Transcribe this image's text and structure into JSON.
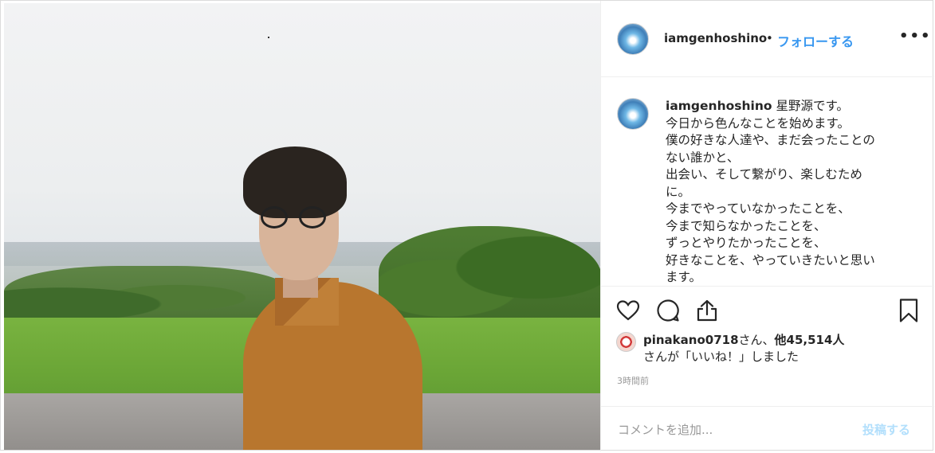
{
  "post": {
    "username": "iamgenhoshino",
    "separator": "•",
    "follow_label": "フォローする",
    "more_label": "•••"
  },
  "caption": {
    "username": "iamgenhoshino",
    "lines": [
      "星野源です。",
      "今日から色んなことを始めます。",
      "僕の好きな人達や、まだ会ったことの",
      "ない誰かと、",
      "出会い、そして繋がり、楽しむため",
      "に。",
      "今までやっていなかったことを、",
      "今まで知らなかったことを、",
      "ずっとやりたかったことを、",
      "好きなことを、やっていきたいと思い",
      "ます。"
    ]
  },
  "actions": {
    "like_icon": "heart-icon",
    "comment_icon": "comment-icon",
    "share_icon": "share-icon",
    "save_icon": "bookmark-icon"
  },
  "likes": {
    "user": "pinakano0718",
    "middle": "さん、",
    "others": "他45,514人",
    "line2": "さんが「いいね！」しました"
  },
  "timestamp": "3時間前",
  "comment": {
    "placeholder": "コメントを追加...",
    "post_label": "投稿する"
  },
  "colors": {
    "link_blue": "#3897f0",
    "post_disabled": "#b2dffc",
    "muted": "#999999"
  }
}
